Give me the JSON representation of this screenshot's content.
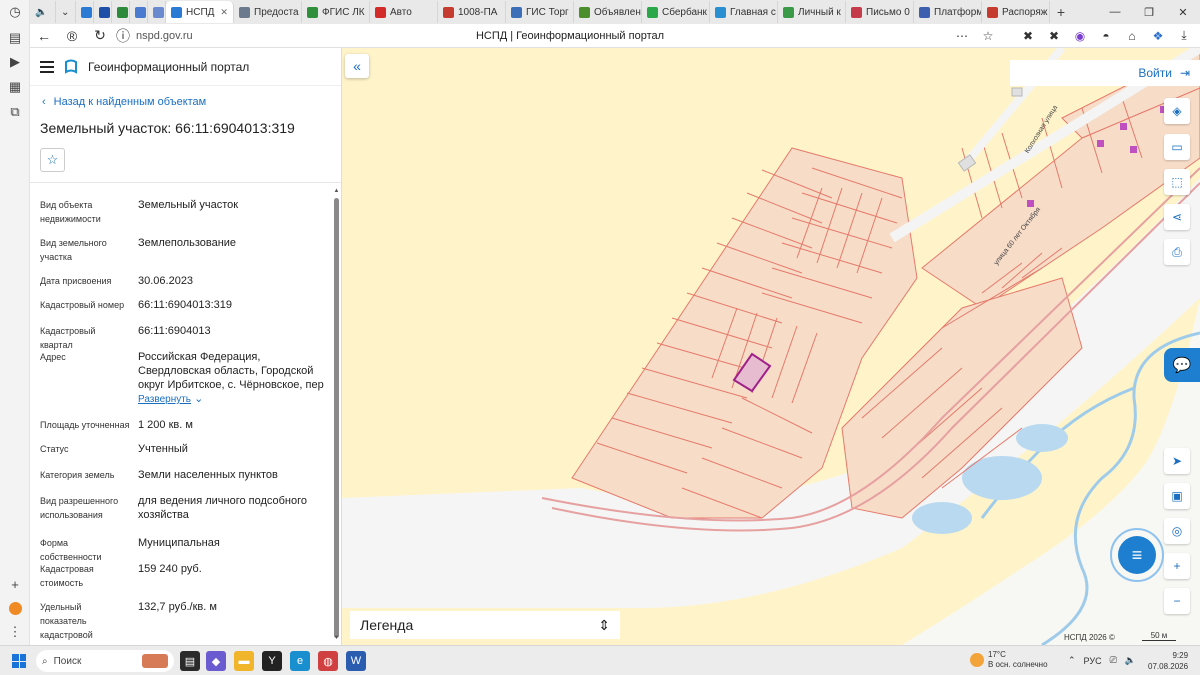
{
  "browser": {
    "tabs": [
      {
        "label": "НСПД",
        "active": true,
        "color": "#2b7bd4"
      },
      {
        "label": "Предоста",
        "color": "#6b7a8c"
      },
      {
        "label": "ФГИС ЛК",
        "color": "#2f8f3a"
      },
      {
        "label": "Авто",
        "color": "#d32a2a"
      },
      {
        "label": "1008-ПА",
        "color": "#c63b2f"
      },
      {
        "label": "ГИС Торг",
        "color": "#3c6fb8"
      },
      {
        "label": "Объявлен",
        "color": "#4b8e2e"
      },
      {
        "label": "Сбербанк",
        "color": "#2aa748"
      },
      {
        "label": "Главная с",
        "color": "#2a8fd0"
      },
      {
        "label": "Личный к",
        "color": "#3a9a48"
      },
      {
        "label": "Письмо 0",
        "color": "#c63b4a"
      },
      {
        "label": "Платформ",
        "color": "#3d5fb0"
      },
      {
        "label": "Распоряж",
        "color": "#c63b2f"
      }
    ],
    "url": "nspd.gov.ru",
    "page_title": "НСПД | Геоинформационный портал"
  },
  "panel": {
    "portal_name": "Геоинформационный портал",
    "back_label": "Назад к найденным объектам",
    "title": "Земельный участок: 66:11:6904013:319",
    "properties": [
      {
        "label": "Вид объекта недвижимости",
        "value": "Земельный участок"
      },
      {
        "label": "Вид земельного участка",
        "value": "Землепользование"
      },
      {
        "label": "Дата присвоения",
        "value": "30.06.2023"
      },
      {
        "label": "Кадастровый номер",
        "value": "66:11:6904013:319"
      },
      {
        "label": "Кадастровый квартал",
        "value": "66:11:6904013"
      },
      {
        "label": "Адрес",
        "value": "Российская Федерация, Свердловская область, Городской округ Ирбитское, с. Чёрновское, пер",
        "expand": "Развернуть"
      },
      {
        "label": "Площадь уточненная",
        "value": "1 200 кв. м"
      },
      {
        "label": "Статус",
        "value": "Учтенный"
      },
      {
        "label": "Категория земель",
        "value": "Земли населенных пунктов"
      },
      {
        "label": "Вид разрешенного использования",
        "value": "для ведения личного подсобного хозяйства"
      },
      {
        "label": "Форма собственности",
        "value": "Муниципальная"
      },
      {
        "label": "Кадастровая стоимость",
        "value": "159 240 руб."
      },
      {
        "label": "Удельный показатель кадастровой стоимости",
        "value": "132,7 руб./кв. м"
      }
    ]
  },
  "map": {
    "login_label": "Войти",
    "legend_label": "Легенда",
    "attribution": "НСПД 2026 ©",
    "scale_label": "50 м",
    "streets": [
      "Колхозная улица",
      "улица 60 лет Октября"
    ],
    "colors": {
      "background": "#fff4c9",
      "parcel_fill": "#f7dcc8",
      "parcel_line": "#e57a6a",
      "selected": "#a0208a",
      "road": "#f4f4f4",
      "water": "#a9d3ef"
    }
  },
  "taskbar": {
    "search_placeholder": "Поиск",
    "weather_temp": "17°C",
    "weather_desc": "В осн. солнечно",
    "lang": "РУС",
    "time": "9:29",
    "date": "07.08.2026"
  }
}
